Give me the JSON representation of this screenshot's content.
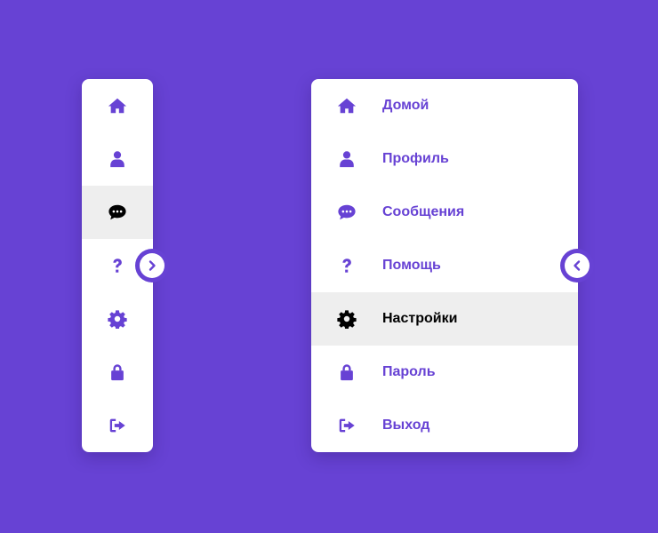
{
  "colors": {
    "background": "#6742d4",
    "accent": "#6742d4",
    "panel": "#ffffff",
    "active_bg": "#eeeeee",
    "active_fg": "#000000"
  },
  "collapsed_menu": {
    "active_index": 2,
    "items": [
      {
        "icon": "home-icon"
      },
      {
        "icon": "user-icon"
      },
      {
        "icon": "chat-icon"
      },
      {
        "icon": "question-icon"
      },
      {
        "icon": "gear-icon"
      },
      {
        "icon": "lock-icon"
      },
      {
        "icon": "logout-icon"
      }
    ],
    "toggle_icon": "chevron-right-icon"
  },
  "expanded_menu": {
    "active_index": 4,
    "items": [
      {
        "icon": "home-icon",
        "label": "Домой"
      },
      {
        "icon": "user-icon",
        "label": "Профиль"
      },
      {
        "icon": "chat-icon",
        "label": "Сообщения"
      },
      {
        "icon": "question-icon",
        "label": "Помощь"
      },
      {
        "icon": "gear-icon",
        "label": "Настройки"
      },
      {
        "icon": "lock-icon",
        "label": "Пароль"
      },
      {
        "icon": "logout-icon",
        "label": "Выход"
      }
    ],
    "toggle_icon": "chevron-left-icon"
  }
}
